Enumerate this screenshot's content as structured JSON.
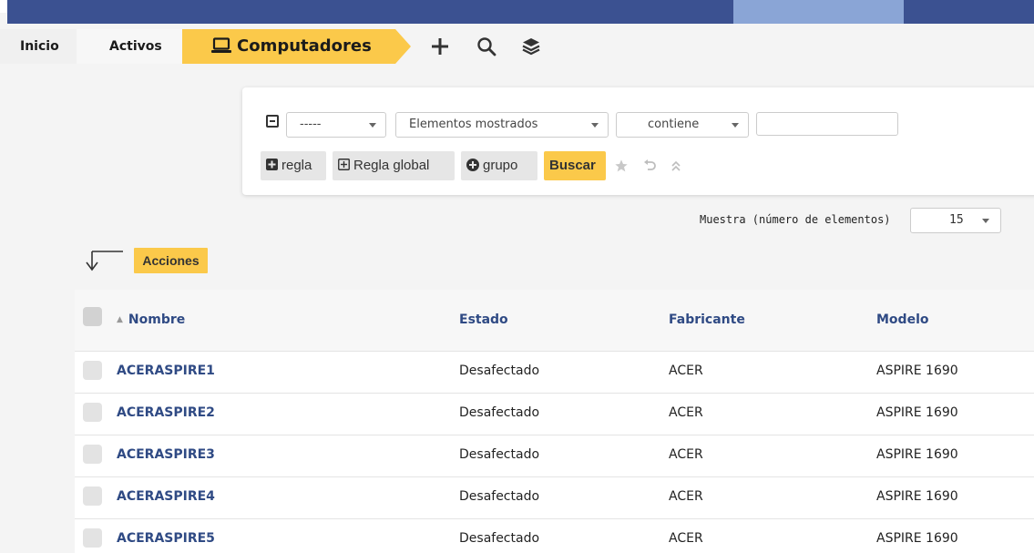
{
  "breadcrumb": {
    "home": "Inicio",
    "section": "Activos",
    "current": "Computadores"
  },
  "icons": {
    "current": "laptop-icon",
    "add": "plus-icon",
    "search": "search-icon",
    "saved": "layers-icon"
  },
  "search": {
    "field_select": "-----",
    "criteria_select": "Elementos mostrados",
    "operator_select": "contiene",
    "value": "",
    "buttons": {
      "rule": "regla",
      "global_rule": "Regla global",
      "group": "grupo",
      "search": "Buscar"
    }
  },
  "display": {
    "label": "Muestra (número de elementos)",
    "value": "15"
  },
  "actions_label": "Acciones",
  "table": {
    "columns": [
      "Nombre",
      "Estado",
      "Fabricante",
      "Modelo"
    ],
    "rows": [
      {
        "name": "ACERASPIRE1",
        "status": "Desafectado",
        "maker": "ACER",
        "model": "ASPIRE 1690"
      },
      {
        "name": "ACERASPIRE2",
        "status": "Desafectado",
        "maker": "ACER",
        "model": "ASPIRE 1690"
      },
      {
        "name": "ACERASPIRE3",
        "status": "Desafectado",
        "maker": "ACER",
        "model": "ASPIRE 1690"
      },
      {
        "name": "ACERASPIRE4",
        "status": "Desafectado",
        "maker": "ACER",
        "model": "ASPIRE 1690"
      },
      {
        "name": "ACERASPIRE5",
        "status": "Desafectado",
        "maker": "ACER",
        "model": "ASPIRE 1690"
      }
    ]
  },
  "colors": {
    "accent": "#fbc94a",
    "topbar": "#3b5191",
    "link": "#2f4a84"
  }
}
